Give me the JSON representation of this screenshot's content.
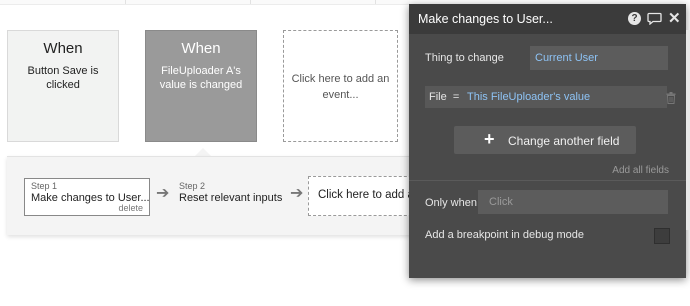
{
  "events": [
    {
      "title": "When",
      "description": "Button Save is clicked"
    },
    {
      "title": "When",
      "description": "FileUploader A's value is changed"
    }
  ],
  "add_event_label": "Click here to add an event...",
  "actions": {
    "steps": [
      {
        "label": "Step 1",
        "name": "Make changes to User...",
        "delete": "delete"
      },
      {
        "label": "Step 2",
        "name": "Reset relevant inputs"
      }
    ],
    "add_action_label": "Click here to add an action..."
  },
  "editor": {
    "title": "Make changes to User...",
    "help_glyph": "?",
    "close_glyph": "✕",
    "thing_to_change_label": "Thing to change",
    "thing_to_change_value": "Current User",
    "field_key": "File",
    "field_op": "=",
    "field_value": "This FileUploader's value",
    "change_another_label": "Change another field",
    "add_all_label": "Add all fields",
    "only_when_label": "Only when",
    "only_when_placeholder": "Click",
    "breakpoint_label": "Add a breakpoint in debug mode"
  },
  "icons": [
    "help-icon",
    "comment-icon",
    "close-icon",
    "trash-icon",
    "plus-icon",
    "arrow-right-icon"
  ],
  "colors": {
    "editor_bg": "#4a4a4a",
    "link_blue": "#8ec3f5",
    "selected_event": "#9a9a9a"
  }
}
